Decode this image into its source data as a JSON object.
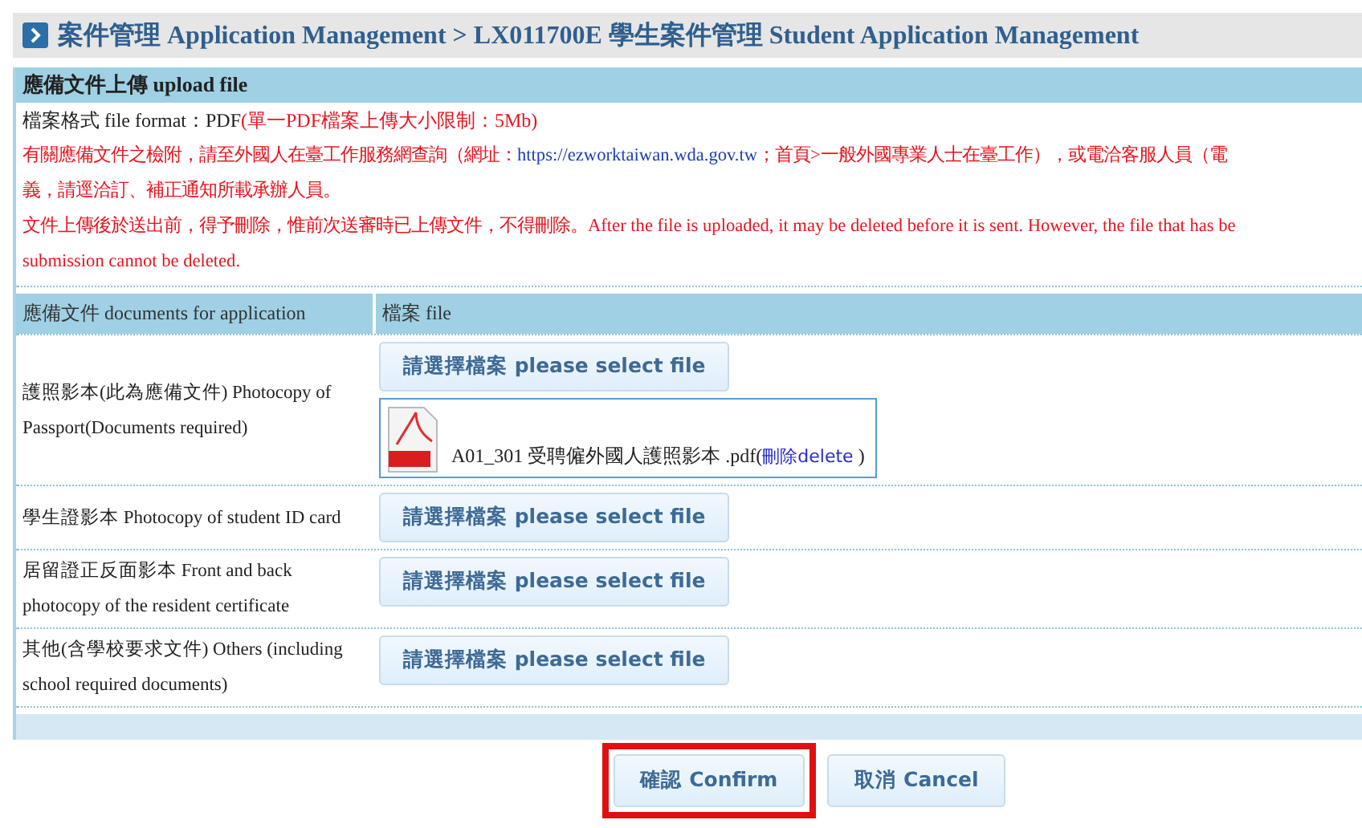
{
  "breadcrumb": "案件管理 Application Management > LX011700E 學生案件管理 Student Application Management",
  "section_title": "應備文件上傳 upload file",
  "file_format": {
    "label": "檔案格式 file format：PDF",
    "limit": "(單一PDF檔案上傳大小限制：5Mb)"
  },
  "notice_lines": [
    {
      "before": "有關應備文件之檢附，請至外國人在臺工作服務網查詢（網址：",
      "link": "https://ezworktaiwan.wda.gov.tw",
      "after": "；首頁>一般外國專業人士在臺工作），或電洽客服人員（電"
    },
    {
      "before": "義，請逕洽訂、補正通知所載承辦人員。"
    },
    {
      "before": "文件上傳後於送出前，得予刪除，惟前次送審時已上傳文件，不得刪除。After the file is uploaded, it may be deleted before it is sent. However, the file that has be"
    },
    {
      "before": "submission cannot be deleted."
    }
  ],
  "table": {
    "columns": [
      "應備文件 documents for application",
      "檔案 file"
    ],
    "rows": [
      {
        "document": "護照影本(此為應備文件) Photocopy of Passport(Documents required)",
        "button": "請選擇檔案 please select file",
        "uploaded": {
          "name": "A01_301 受聘僱外國人護照影本 .pdf(",
          "delete": "刪除delete",
          "close": ")"
        }
      },
      {
        "document": "學生證影本 Photocopy of student ID card",
        "button": "請選擇檔案 please select file"
      },
      {
        "document": "居留證正反面影本 Front and back photocopy of the resident certificate",
        "button": "請選擇檔案 please select file"
      },
      {
        "document": "其他(含學校要求文件) Others (including school required documents)",
        "button": "請選擇檔案 please select file"
      }
    ]
  },
  "actions": [
    {
      "label": "確認 Confirm",
      "highlighted": true
    },
    {
      "label": "取消 Cancel",
      "highlighted": false
    }
  ]
}
